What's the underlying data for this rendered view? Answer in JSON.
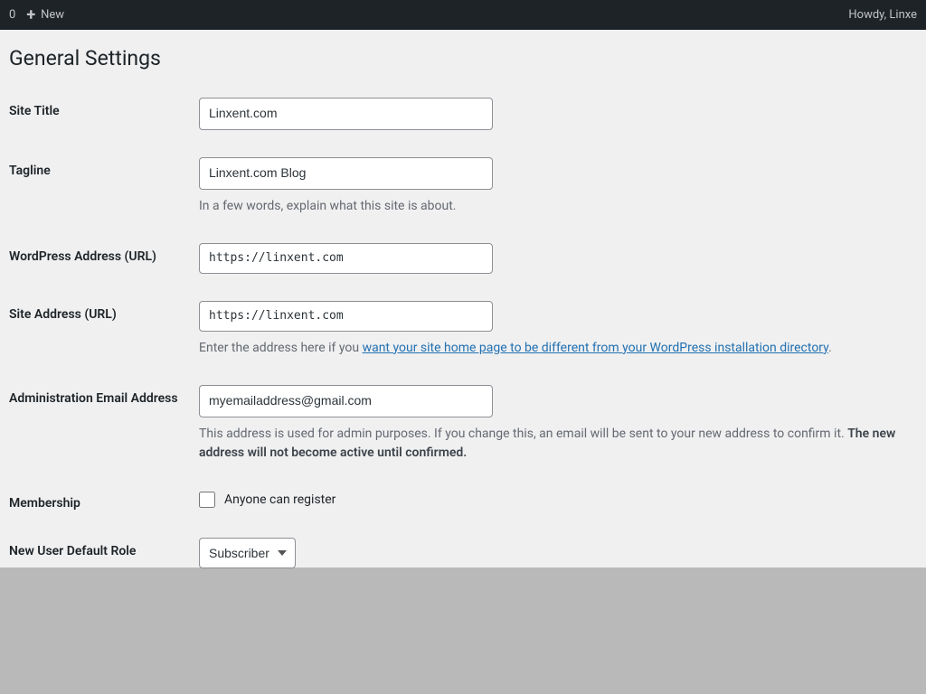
{
  "adminBar": {
    "commentCount": "0",
    "newLabel": "New",
    "greeting": "Howdy, Linxe"
  },
  "header": {
    "title": "General Settings"
  },
  "form": {
    "siteTitle": {
      "label": "Site Title",
      "value": "Linxent.com"
    },
    "tagline": {
      "label": "Tagline",
      "value": "Linxent.com Blog",
      "description": "In a few words, explain what this site is about."
    },
    "wpAddress": {
      "label": "WordPress Address (URL)",
      "value": "https://linxent.com"
    },
    "siteAddress": {
      "label": "Site Address (URL)",
      "value": "https://linxent.com",
      "descriptionPrefix": "Enter the address here if you ",
      "descriptionLink": "want your site home page to be different from your WordPress installation directory",
      "descriptionSuffix": "."
    },
    "adminEmail": {
      "label": "Administration Email Address",
      "value": "myemailaddress@gmail.com",
      "descriptionPrefix": "This address is used for admin purposes. If you change this, an email will be sent to your new address to confirm it. ",
      "descriptionBold": "The new address will not become active until confirmed."
    },
    "membership": {
      "label": "Membership",
      "checkboxLabel": "Anyone can register"
    },
    "defaultRole": {
      "label": "New User Default Role",
      "value": "Subscriber"
    }
  }
}
